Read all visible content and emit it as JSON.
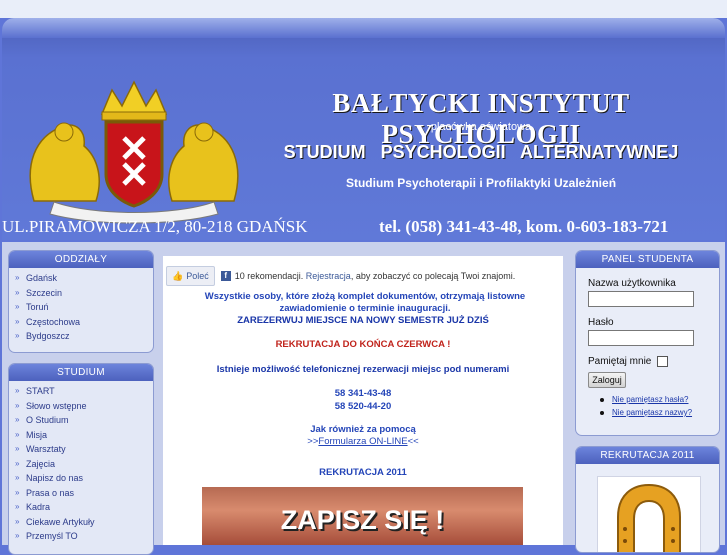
{
  "header": {
    "title": "BAŁTYCKI INSTYTUT PSYCHOLOGII",
    "subtitle": "placówka oświatowa",
    "program": "STUDIUM  PSYCHOLOGII  ALTERNATYWNEJ",
    "program_sub": "Studium Psychoterapii i Profilaktyki Uzależnień",
    "address": "UL.PIRAMOWICZA 1/2, 80-218 GDAŃSK",
    "phone": "tel. (058) 341-43-48, kom. 0-603-183-721"
  },
  "oddzialy": {
    "heading": "ODDZIAŁY",
    "items": [
      "Gdańsk",
      "Szczecin",
      "Toruń",
      "Częstochowa",
      "Bydgoszcz"
    ]
  },
  "studium": {
    "heading": "STUDIUM",
    "items": [
      "START",
      "Słowo wstępne",
      "O Studium",
      "Misja",
      "Warsztaty",
      "Zajęcia",
      "Napisz do nas",
      "Prasa o nas",
      "Kadra",
      "Ciekawe Artykuły",
      "Przemyśl TO"
    ]
  },
  "facebook": {
    "like_label": "Poleć",
    "count_text": "10 rekomendacji.",
    "register_link": "Rejestracja",
    "tail_text": ", aby zobaczyć co polecają Twoi znajomi."
  },
  "main": {
    "line1": "Wszystkie osoby, które złożą komplet dokumentów, otrzymają  listowne zawiadomienie o terminie inauguracji.",
    "line2": "ZAREZERWUJ MIEJSCE NA NOWY SEMESTR JUŻ DZIŚ",
    "line3": "REKRUTACJA DO KOŃCA CZERWCA !",
    "line4": "Istnieje możliwość telefonicznej rezerwacji miejsc pod numerami",
    "phone1": "58 341-43-48",
    "phone2": "58 520-44-20",
    "help": "Jak również za pomocą",
    "form_prefix": ">>",
    "form_link": "Formularza ON-LINE",
    "form_suffix": "<<",
    "rekrutacja": "REKRUTACJA  2011",
    "promo_text": "ZAPISZ SIĘ !"
  },
  "panel": {
    "heading": "PANEL STUDENTA",
    "username_label": "Nazwa użytkownika",
    "password_label": "Hasło",
    "remember_label": "Pamiętaj mnie",
    "login_button": "Zaloguj",
    "forgot_password": "Nie pamiętasz hasła?",
    "forgot_username": "Nie pamiętasz nazwy?"
  },
  "rekrutacja_box": {
    "heading": "REKRUTACJA 2011"
  },
  "colors": {
    "header_blue": "#5a71d1",
    "link_blue": "#2445b8",
    "red_notice": "#c0241c"
  }
}
